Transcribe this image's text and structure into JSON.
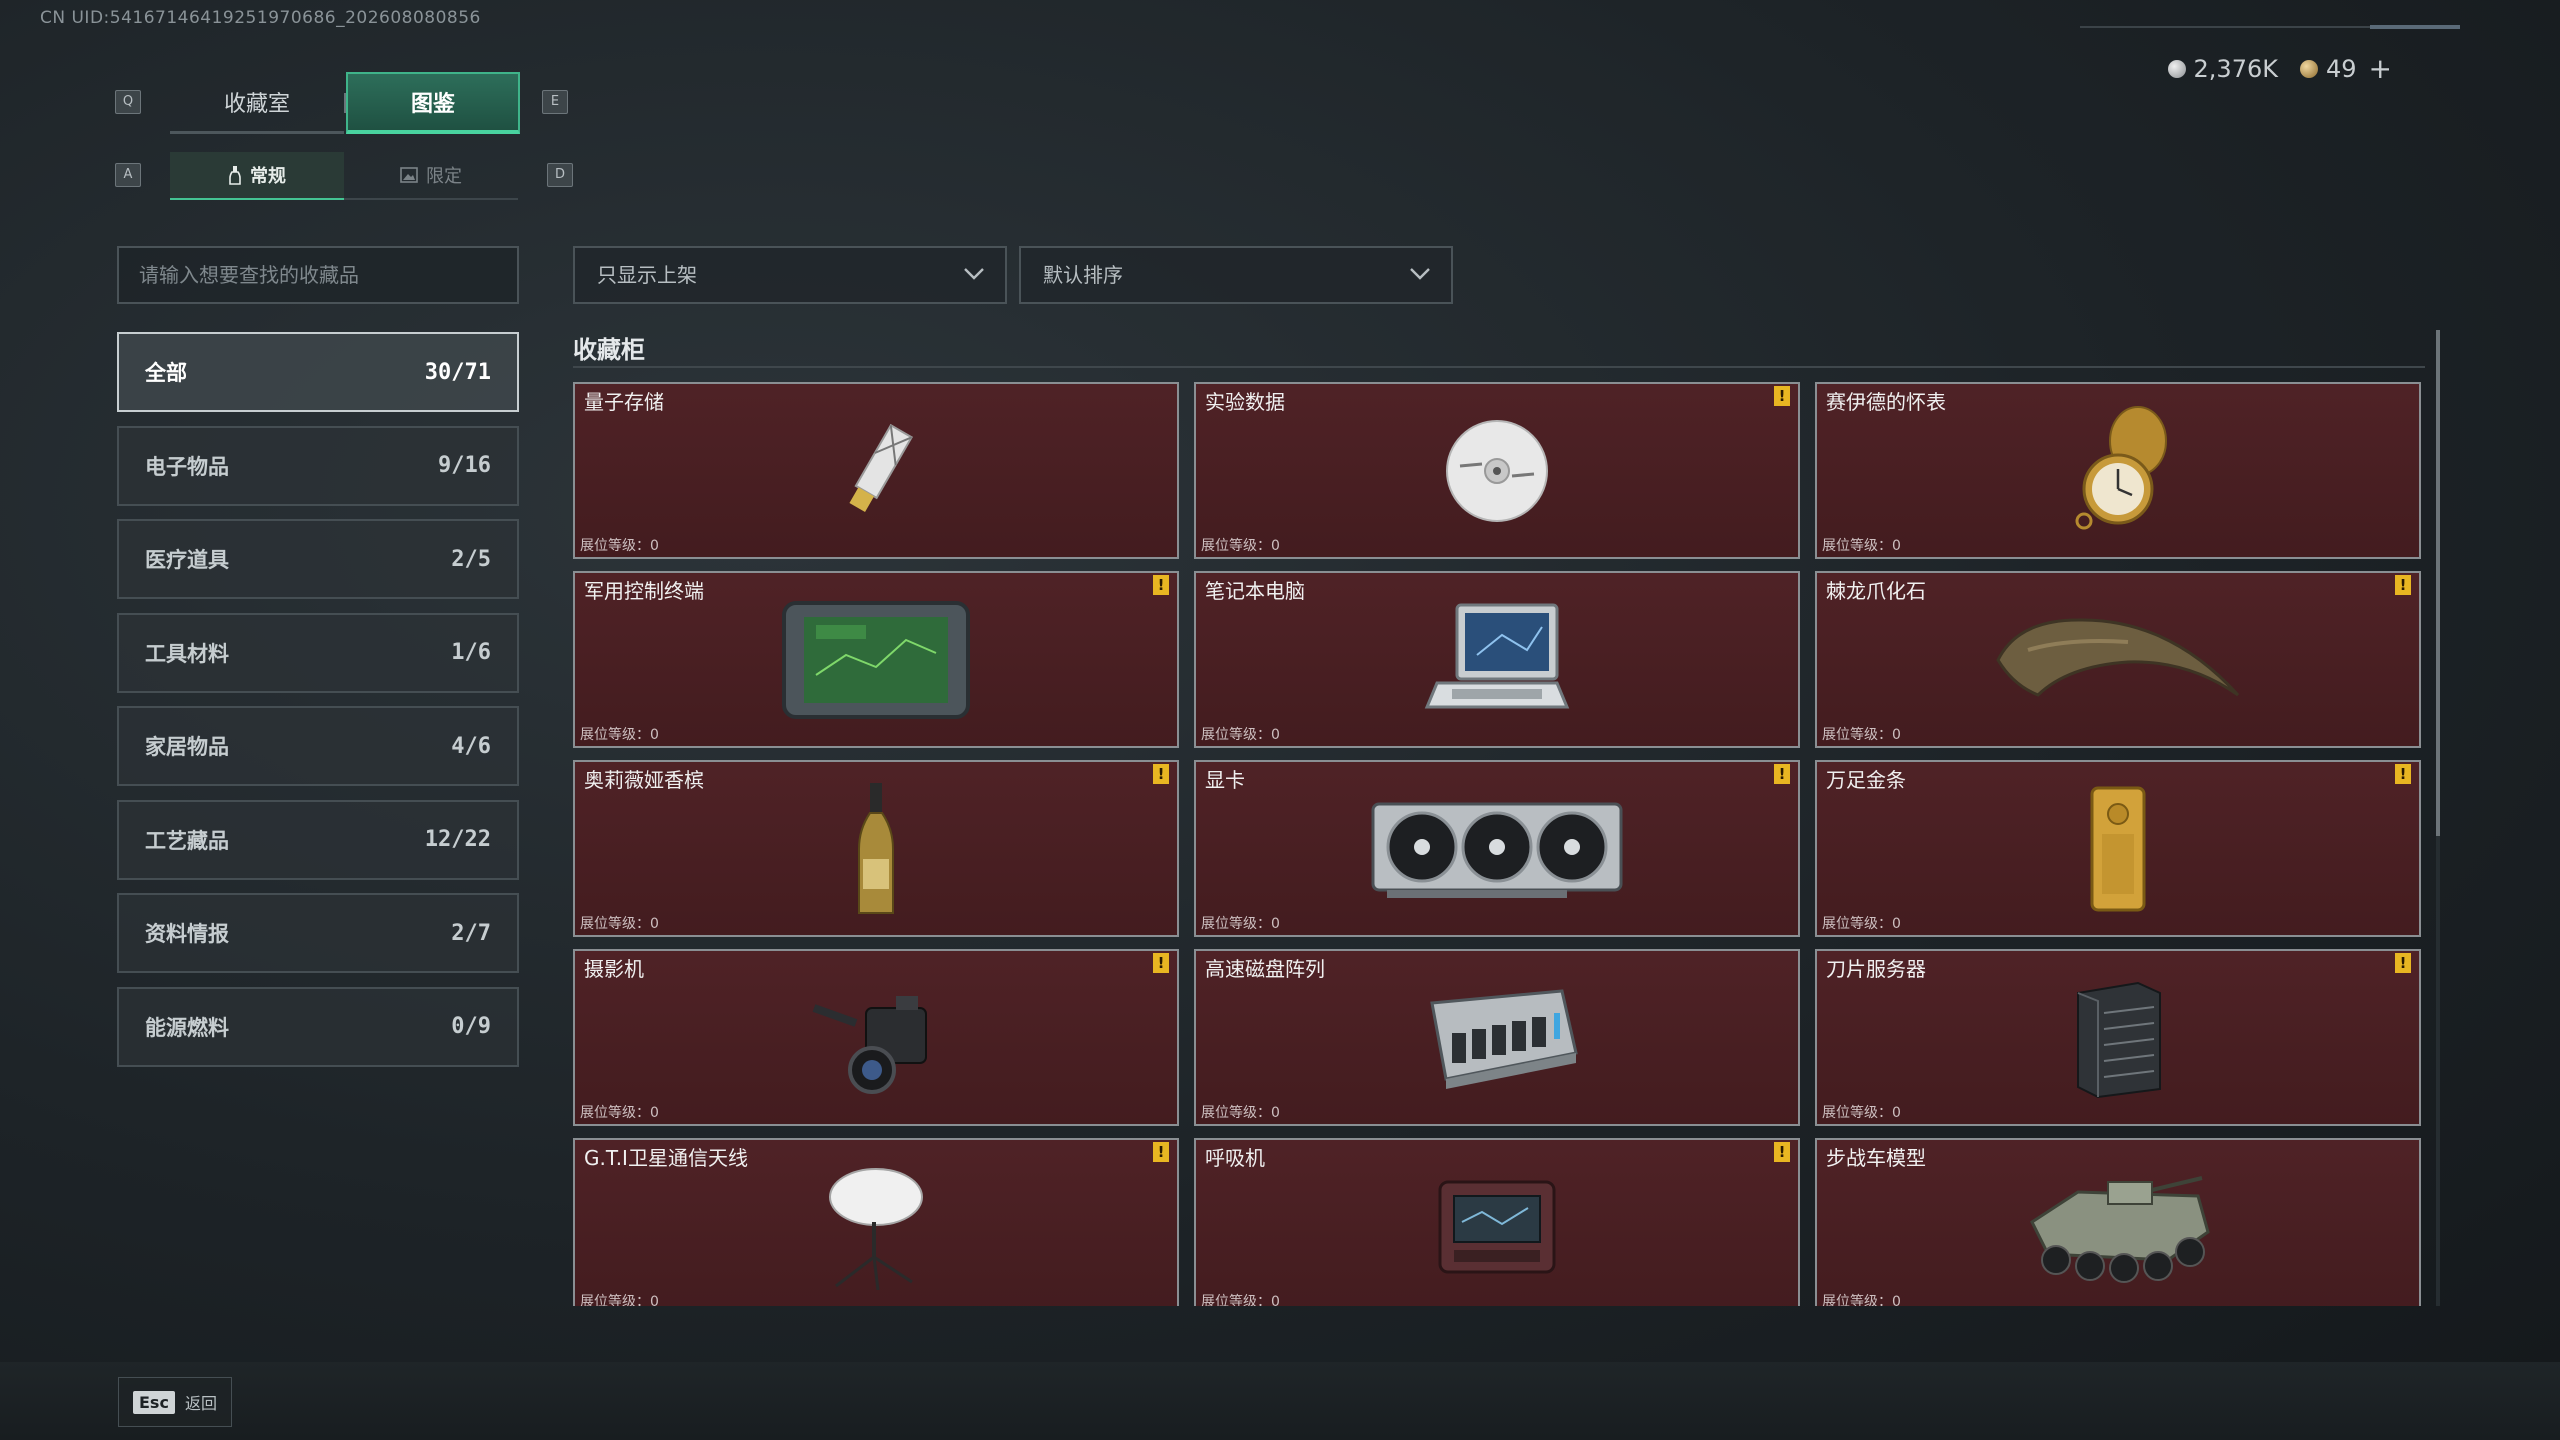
{
  "uid_text": "CN UID:54167146419251970686_202608080856",
  "currency": {
    "silver": "2,376K",
    "gold": "49",
    "plus": "+"
  },
  "keys": {
    "q": "Q",
    "e": "E",
    "a": "A",
    "d": "D"
  },
  "main_tabs": [
    {
      "label": "收藏室"
    },
    {
      "label": "图鉴"
    }
  ],
  "sub_tabs": [
    {
      "label": "常规"
    },
    {
      "label": "限定"
    }
  ],
  "search": {
    "placeholder": "请输入想要查找的收藏品"
  },
  "categories": [
    {
      "label": "全部",
      "count": "30/71"
    },
    {
      "label": "电子物品",
      "count": "9/16"
    },
    {
      "label": "医疗道具",
      "count": "2/5"
    },
    {
      "label": "工具材料",
      "count": "1/6"
    },
    {
      "label": "家居物品",
      "count": "4/6"
    },
    {
      "label": "工艺藏品",
      "count": "12/22"
    },
    {
      "label": "资料情报",
      "count": "2/7"
    },
    {
      "label": "能源燃料",
      "count": "0/9"
    }
  ],
  "filters": {
    "shelf": "只显示上架",
    "sort": "默认排序"
  },
  "section_title": "收藏柜",
  "level_text": "展位等级：0",
  "items": [
    {
      "name": "量子存储",
      "alert": false,
      "icon": "usb-stick-icon"
    },
    {
      "name": "实验数据",
      "alert": true,
      "icon": "disc-icon"
    },
    {
      "name": "赛伊德的怀表",
      "alert": false,
      "icon": "pocket-watch-icon"
    },
    {
      "name": "军用控制终端",
      "alert": true,
      "icon": "tablet-terminal-icon"
    },
    {
      "name": "笔记本电脑",
      "alert": false,
      "icon": "laptop-icon"
    },
    {
      "name": "棘龙爪化石",
      "alert": true,
      "icon": "claw-fossil-icon"
    },
    {
      "name": "奥莉薇娅香槟",
      "alert": true,
      "icon": "champagne-bottle-icon"
    },
    {
      "name": "显卡",
      "alert": true,
      "icon": "graphics-card-icon"
    },
    {
      "name": "万足金条",
      "alert": true,
      "icon": "gold-bar-icon"
    },
    {
      "name": "摄影机",
      "alert": true,
      "icon": "video-camera-icon"
    },
    {
      "name": "高速磁盘阵列",
      "alert": false,
      "icon": "disk-array-icon"
    },
    {
      "name": "刀片服务器",
      "alert": true,
      "icon": "blade-server-icon"
    },
    {
      "name": "G.T.I卫星通信天线",
      "alert": true,
      "icon": "satellite-dish-icon"
    },
    {
      "name": "呼吸机",
      "alert": true,
      "icon": "ventilator-icon"
    },
    {
      "name": "步战车模型",
      "alert": false,
      "icon": "ifv-model-icon"
    }
  ],
  "alert_mark": "!",
  "footer": {
    "esc_key": "Esc",
    "esc_label": "返回"
  }
}
